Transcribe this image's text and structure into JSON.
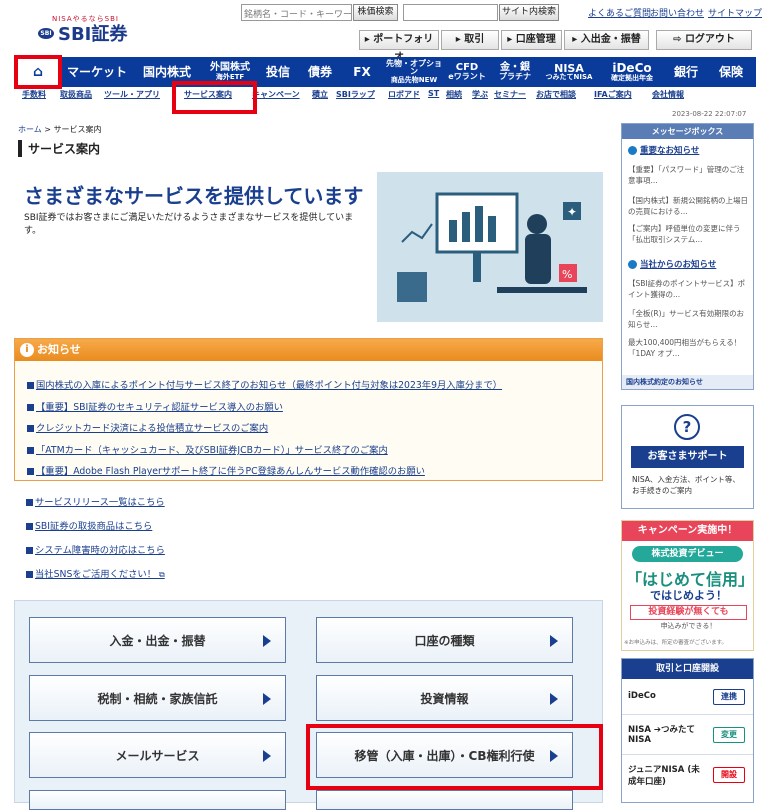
{
  "header": {
    "logo_tagline": "NISAやるならSBI",
    "logo_text": "SBI証券",
    "stock_search_placeholder": "銘柄名・コード・キーワード",
    "stock_search_button": "株価検索",
    "site_search_button": "サイト内検索",
    "links": [
      "よくあるご質問",
      "お問い合わせ",
      "サイトマップ"
    ],
    "subnav": [
      "ポートフォリオ",
      "取引",
      "口座管理",
      "入出金・振替"
    ],
    "logout": "ログアウト"
  },
  "main_nav": {
    "home_icon": "home-icon",
    "items": [
      "マーケット",
      "国内株式",
      "外国株式",
      "投信",
      "債券",
      "FX",
      "先物・オプション",
      "CFD",
      "金・銀",
      "NISA",
      "iDeCo",
      "銀行",
      "保険"
    ],
    "sub": [
      "",
      "",
      "海外ETF",
      "",
      "",
      "",
      "商品先物NEW",
      "eワラント",
      "プラチナ",
      "つみたてNISA",
      "確定拠出年金",
      "",
      ""
    ]
  },
  "secondary_nav": [
    "手数料",
    "取扱商品",
    "ツール・アプリ",
    "サービス案内",
    "キャンペーン",
    "積立",
    "SBIラップ",
    "ロボアド",
    "ST",
    "相続",
    "学ぶ",
    "セミナー",
    "お店で相談",
    "IFAご案内",
    "会社情報"
  ],
  "timestamp": "2023-08-22 22:07:07",
  "breadcrumb": {
    "home": "ホーム",
    "current": "サービス案内"
  },
  "page_title": "サービス案内",
  "hero": {
    "heading": "さまざまなサービスを提供しています",
    "description": "SBI証券ではお客さまにご満足いただけるようさまざまなサービスを提供しています。"
  },
  "notice": {
    "title": "お知らせ",
    "items": [
      "国内株式の入庫によるポイント付与サービス終了のお知らせ（最終ポイント付与対象は2023年9月入庫分まで）",
      "【重要】SBI証券のセキュリティ認証サービス導入のお願い",
      "クレジットカード決済による投信積立サービスのご案内",
      "「ATMカード（キャッシュカード、及びSBI証券JCBカード）」サービス終了のご案内",
      "【重要】Adobe Flash Playerサポート終了に伴うPC登録あんしんサービス動作確認のお願い"
    ]
  },
  "links": [
    "サービスリリース一覧はこちら",
    "SBI証券の取扱商品はこちら",
    "システム障害時の対応はこちら",
    "当社SNSをご活用ください！"
  ],
  "tiles": [
    "入金・出金・振替",
    "口座の種類",
    "税制・相続・家族信託",
    "投資情報",
    "メールサービス",
    "移管（入庫・出庫）・CB権利行使"
  ],
  "sidebar": {
    "message_box": {
      "title": "メッセージボックス",
      "important_label": "重要なお知らせ",
      "important_items": [
        "【重要】「パスワード」管理のご注意事項...",
        "【国内株式】新規公開銘柄の上場日の売買における...",
        "【ご案内】呼値単位の変更に伴う「払出取引システム..."
      ],
      "company_label": "当社からのお知らせ",
      "company_items": [
        "【SBI証券のポイントサービス】ポイント獲得の...",
        "「全板(R)」サービス有効期限のお知らせ...",
        "最大100,400円相当がもらえる！「1DAY オプ..."
      ],
      "footer": "国内株式約定のお知らせ"
    },
    "support": {
      "button": "お客さまサポート",
      "description": "NISA、入金方法、ポイント等、お手続きのご案内"
    },
    "campaign": {
      "header": "キャンペーン実施中！",
      "sub": "株式投資デビュー",
      "main": "「はじめて信用」",
      "main2": "ではじめよう！",
      "note": "投資経験が無くても",
      "note2": "申込みができる！",
      "small": "※お申込みは、所定の審査がございます。"
    },
    "accounts": {
      "title": "取引と口座開設",
      "rows": [
        {
          "label": "iDeCo",
          "button": "連携"
        },
        {
          "label": "NISA ➔つみたてNISA",
          "button": "変更"
        },
        {
          "label": "ジュニアNISA (未成年口座)",
          "button": "開設"
        }
      ]
    }
  },
  "colors": {
    "brand_blue": "#0a3a9a",
    "highlight_red": "#e60012",
    "notice_orange": "#e98c1e"
  }
}
